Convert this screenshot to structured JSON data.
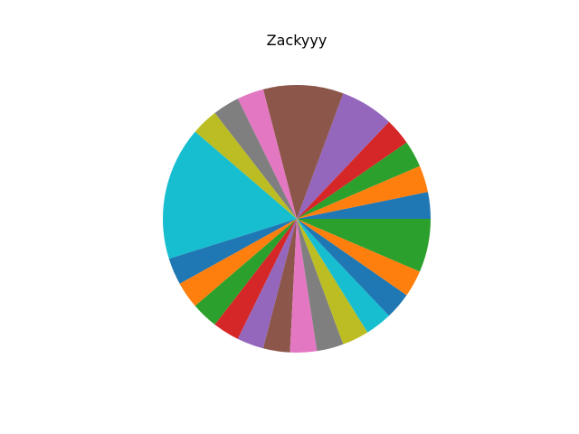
{
  "chart_data": {
    "type": "pie",
    "title": "Zackyyy",
    "start_angle_deg": 0,
    "direction": "counterclockwise",
    "slices": [
      {
        "value": 3,
        "color": "#1f77b4"
      },
      {
        "value": 3,
        "color": "#ff7f0e"
      },
      {
        "value": 3,
        "color": "#2ca02c"
      },
      {
        "value": 3,
        "color": "#d62728"
      },
      {
        "value": 6,
        "color": "#9467bd"
      },
      {
        "value": 9,
        "color": "#8c564b"
      },
      {
        "value": 3,
        "color": "#e377c2"
      },
      {
        "value": 3,
        "color": "#7f7f7f"
      },
      {
        "value": 3,
        "color": "#bcbd22"
      },
      {
        "value": 15,
        "color": "#17becf"
      },
      {
        "value": 3,
        "color": "#1f77b4"
      },
      {
        "value": 3,
        "color": "#ff7f0e"
      },
      {
        "value": 3,
        "color": "#2ca02c"
      },
      {
        "value": 3,
        "color": "#d62728"
      },
      {
        "value": 3,
        "color": "#9467bd"
      },
      {
        "value": 3,
        "color": "#8c564b"
      },
      {
        "value": 3,
        "color": "#e377c2"
      },
      {
        "value": 3,
        "color": "#7f7f7f"
      },
      {
        "value": 3,
        "color": "#bcbd22"
      },
      {
        "value": 3,
        "color": "#17becf"
      },
      {
        "value": 3,
        "color": "#1f77b4"
      },
      {
        "value": 3,
        "color": "#ff7f0e"
      },
      {
        "value": 6,
        "color": "#2ca02c"
      }
    ]
  }
}
